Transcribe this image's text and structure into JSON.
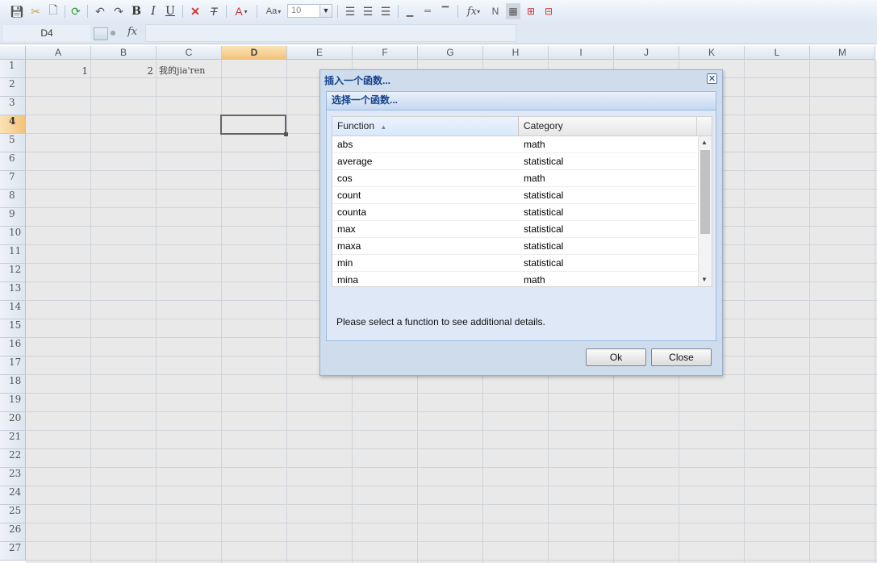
{
  "toolbar": {
    "font_size": "10",
    "fx_label": "fx"
  },
  "formula_bar": {
    "name_box": "D4",
    "fx_label": "fx",
    "value": ""
  },
  "sheet": {
    "columns": [
      "A",
      "B",
      "C",
      "D",
      "E",
      "F",
      "G",
      "H",
      "I",
      "J",
      "K",
      "L",
      "M"
    ],
    "selected_column": "D",
    "rows": [
      "1",
      "2",
      "3",
      "4",
      "5",
      "6",
      "7",
      "8",
      "9",
      "10",
      "11",
      "12",
      "13",
      "14",
      "15",
      "16",
      "17",
      "18",
      "19",
      "20",
      "21",
      "22",
      "23",
      "24",
      "25",
      "26",
      "27"
    ],
    "selected_row": "4",
    "cells": {
      "A1": "1",
      "B1": "2",
      "C1": "我的jia'ren"
    }
  },
  "dialog": {
    "title": "插入一个函数...",
    "close_glyph": "✕",
    "panel_title": "选择一个函数...",
    "col_function": "Function",
    "col_category": "Category",
    "functions": [
      {
        "name": "abs",
        "category": "math"
      },
      {
        "name": "average",
        "category": "statistical"
      },
      {
        "name": "cos",
        "category": "math"
      },
      {
        "name": "count",
        "category": "statistical"
      },
      {
        "name": "counta",
        "category": "statistical"
      },
      {
        "name": "max",
        "category": "statistical"
      },
      {
        "name": "maxa",
        "category": "statistical"
      },
      {
        "name": "min",
        "category": "statistical"
      },
      {
        "name": "mina",
        "category": "math"
      }
    ],
    "details": "Please select a function to see additional details.",
    "ok_label": "Ok",
    "close_label": "Close"
  }
}
